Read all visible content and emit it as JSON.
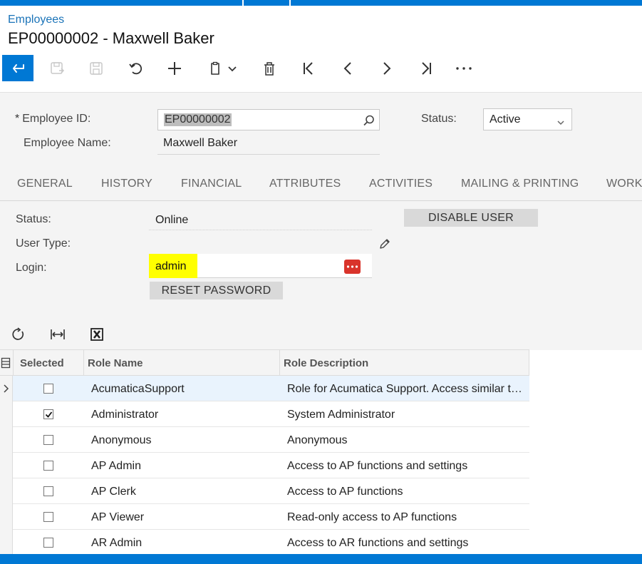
{
  "breadcrumb": "Employees",
  "title": "EP00000002 - Maxwell Baker",
  "header": {
    "employee_id_label": "Employee ID:",
    "employee_id_required": "*",
    "employee_id_value": "EP00000002",
    "employee_name_label": "Employee Name:",
    "employee_name_value": "Maxwell Baker",
    "status_label": "Status:",
    "status_value": "Active"
  },
  "tabs": [
    "GENERAL",
    "HISTORY",
    "FINANCIAL",
    "ATTRIBUTES",
    "ACTIVITIES",
    "MAILING & PRINTING",
    "WORK"
  ],
  "user": {
    "status_label": "Status:",
    "status_value": "Online",
    "user_type_label": "User Type:",
    "user_type_value": "",
    "login_label": "Login:",
    "login_value": "admin",
    "disable_user": "DISABLE USER",
    "reset_password": "RESET PASSWORD"
  },
  "grid": {
    "columns": [
      "Selected",
      "Role Name",
      "Role Description"
    ],
    "rows": [
      {
        "selected": false,
        "name": "AcumaticaSupport",
        "description": "Role for Acumatica Support. Access similar to Administrator",
        "active": true
      },
      {
        "selected": true,
        "name": "Administrator",
        "description": "System Administrator"
      },
      {
        "selected": false,
        "name": "Anonymous",
        "description": "Anonymous"
      },
      {
        "selected": false,
        "name": "AP Admin",
        "description": "Access to AP functions and settings"
      },
      {
        "selected": false,
        "name": "AP Clerk",
        "description": "Access to AP functions"
      },
      {
        "selected": false,
        "name": "AP Viewer",
        "description": "Read-only access to AP functions"
      },
      {
        "selected": false,
        "name": "AR Admin",
        "description": "Access to AR functions and settings"
      }
    ]
  },
  "icons": {
    "back": "back-arrow-icon",
    "save_close": "save-close-icon",
    "save": "save-icon",
    "cancel": "undo-icon",
    "add": "plus-icon",
    "copy": "clipboard-icon",
    "delete": "trash-icon",
    "first": "first-icon",
    "prev": "previous-icon",
    "next": "next-icon",
    "last": "last-icon",
    "more": "more-icon"
  },
  "colors": {
    "accent": "#0078d4",
    "highlight": "#ffff00",
    "login_button": "#d9342b"
  }
}
